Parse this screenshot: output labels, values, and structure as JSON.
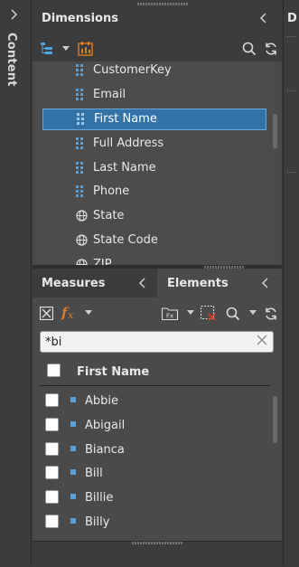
{
  "rail": {
    "label": "Content"
  },
  "dimensions": {
    "title": "Dimensions",
    "items": [
      {
        "label": "CustomerKey",
        "icon": "hierarchy-icon"
      },
      {
        "label": "Email",
        "icon": "hierarchy-icon"
      },
      {
        "label": "First Name",
        "icon": "hierarchy-icon",
        "selected": true
      },
      {
        "label": "Full Address",
        "icon": "hierarchy-icon"
      },
      {
        "label": "Last Name",
        "icon": "hierarchy-icon"
      },
      {
        "label": "Phone",
        "icon": "hierarchy-icon"
      },
      {
        "label": "State",
        "icon": "globe-icon"
      },
      {
        "label": "State Code",
        "icon": "globe-icon"
      },
      {
        "label": "ZIP",
        "icon": "globe-icon"
      }
    ]
  },
  "tabs": {
    "measures": "Measures",
    "elements": "Elements"
  },
  "elements": {
    "search_value": "*bi",
    "column_header": "First Name",
    "items": [
      "Abbie",
      "Abigail",
      "Bianca",
      "Bill",
      "Billie",
      "Billy"
    ]
  },
  "right_panel": {
    "initial": "D"
  },
  "colors": {
    "selection": "#3373a8",
    "accent_orange": "#e07a1f",
    "accent_red": "#d93a2b",
    "item_blue": "#5a9fd6"
  }
}
